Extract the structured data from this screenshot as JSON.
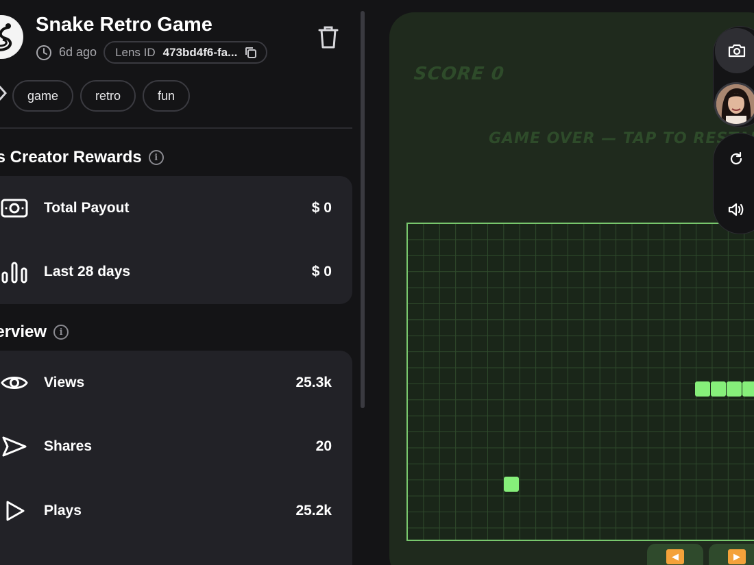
{
  "header": {
    "title": "Snake Retro Game",
    "time_ago": "6d ago",
    "lens_id_label": "Lens ID",
    "lens_id_value": "473bd4f6-fa..."
  },
  "tags": [
    "game",
    "retro",
    "fun"
  ],
  "rewards": {
    "title": "ns Creator Rewards",
    "rows": [
      {
        "label": "Total Payout",
        "value": "$ 0",
        "icon": "money-icon"
      },
      {
        "label": "Last 28 days",
        "value": "$ 0",
        "icon": "bar-chart-icon"
      }
    ]
  },
  "overview": {
    "title": "verview",
    "rows": [
      {
        "label": "Views",
        "value": "25.3k",
        "icon": "eye-icon"
      },
      {
        "label": "Shares",
        "value": "20",
        "icon": "send-icon"
      },
      {
        "label": "Plays",
        "value": "25.2k",
        "icon": "play-icon"
      }
    ]
  },
  "game": {
    "score_text": "SCORE 0",
    "gameover_text": "GAME OVER — TAP TO RESTART",
    "snake_color": "#86ef7a",
    "board_border_color": "#78c76d",
    "button_color": "#f4a23a"
  },
  "toolbar": {
    "icons": [
      "camera-icon",
      "face-avatar",
      "refresh-icon",
      "speaker-icon"
    ]
  }
}
